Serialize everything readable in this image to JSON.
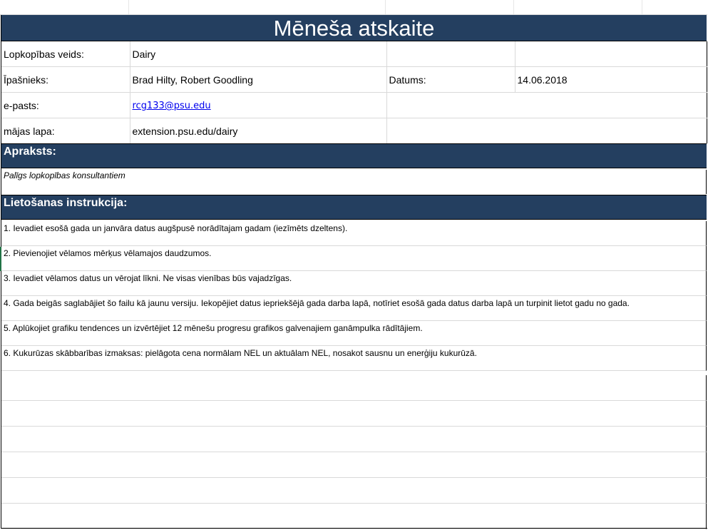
{
  "title": "Mēneša atskaite",
  "info": {
    "farm_type_label": "Lopkopības veids:",
    "farm_type_value": "Dairy",
    "owner_label": "Īpašnieks:",
    "owner_value": "Brad Hilty, Robert Goodling",
    "date_label": "Datums:",
    "date_value": "14.06.2018",
    "email_label": "e-pasts:",
    "email_value": "rcg133@psu.edu",
    "website_label": "mājas lapa:",
    "website_value": "extension.psu.edu/dairy"
  },
  "description": {
    "header": "Apraksts:",
    "text": "Palīgs lopkopības konsultantiem"
  },
  "instructions": {
    "header": "Lietošanas instrukcija:",
    "items": [
      "1. Ievadiet esošā gada un janvāra datus augšpusē norādītajam gadam (iezīmēts dzeltens).",
      "2. Pievienojiet vēlamos mērķus vēlamajos daudzumos.",
      "3. Ievadiet vēlamos datus un vērojat līkni. Ne visas vienības būs vajadzīgas.",
      "4. Gada beigās saglabājiet šo failu kā jaunu versiju. Iekopējiet datus iepriekšējā gada darba lapā, notīriet esošā gada datus darba lapā un turpinit lietot gadu no gada.",
      "5. Aplūkojiet grafiku tendences un izvērtējiet 12 mēnešu progresu grafikos galvenajiem ganāmpulka rādītājiem.",
      "6. Kukurūzas skābbarības izmaksas: pielāgota cena normālam NEL un aktuālam NEL, nosakot sausnu un enerģiju kukurūzā."
    ]
  },
  "colors": {
    "header_bg": "#243f60",
    "header_text": "#ffffff",
    "link": "#0000ee"
  }
}
